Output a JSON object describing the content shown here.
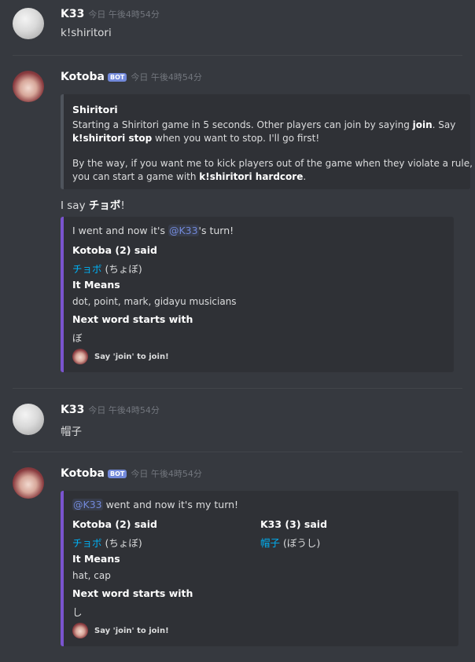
{
  "messages": {
    "m1": {
      "username": "K33",
      "timestamp": "今日 午後4時54分",
      "text": "k!shiritori"
    },
    "m2": {
      "username": "Kotoba",
      "bot_tag": "BOT",
      "timestamp": "今日 午後4時54分",
      "embed": {
        "title": "Shiritori",
        "desc_1a": "Starting a Shiritori game in 5 seconds. Other players can join by saying ",
        "desc_1b": "join",
        "desc_1c": ". Say",
        "desc_2a": "k!shiritori stop",
        "desc_2b": " when you want to stop. I'll go first!",
        "desc_3": "By the way, if you want me to kick players out of the game when they violate a rule,",
        "desc_4a": "you can start a game with ",
        "desc_4b": "k!shiritori hardcore",
        "desc_4c": "."
      },
      "say_prefix": "I say ",
      "say_word": "チョボ",
      "say_suffix": "!",
      "embed2": {
        "desc_a": "I went and now it's ",
        "mention": "@K33",
        "desc_b": "'s turn!",
        "field1_name": "Kotoba (2) said",
        "field1_word": "チョボ",
        "field1_reading": " (ちょぼ)",
        "field2_name": "It Means",
        "field2_value": "dot, point, mark, gidayu musicians",
        "field3_name": "Next word starts with",
        "field3_value": "ぼ",
        "footer": "Say 'join' to join!"
      }
    },
    "m3": {
      "username": "K33",
      "timestamp": "今日 午後4時54分",
      "text": "帽子"
    },
    "m4": {
      "username": "Kotoba",
      "bot_tag": "BOT",
      "timestamp": "今日 午後4時54分",
      "embed": {
        "mention": "@K33",
        "desc": " went and now it's my turn!",
        "field1_name": "Kotoba (2) said",
        "field1_word": "チョボ",
        "field1_reading": " (ちょぼ)",
        "field1b_name": "K33 (3) said",
        "field1b_word": "帽子",
        "field1b_reading": " (ぼうし)",
        "field2_name": "It Means",
        "field2_value": "hat, cap",
        "field3_name": "Next word starts with",
        "field3_value": "し",
        "footer": "Say 'join' to join!"
      }
    }
  },
  "colors": {
    "background": "#36393f",
    "embed_bg": "#2f3136",
    "embed_accent": "#7a54cf",
    "link": "#00b0f4",
    "bot_tag": "#7289da"
  }
}
